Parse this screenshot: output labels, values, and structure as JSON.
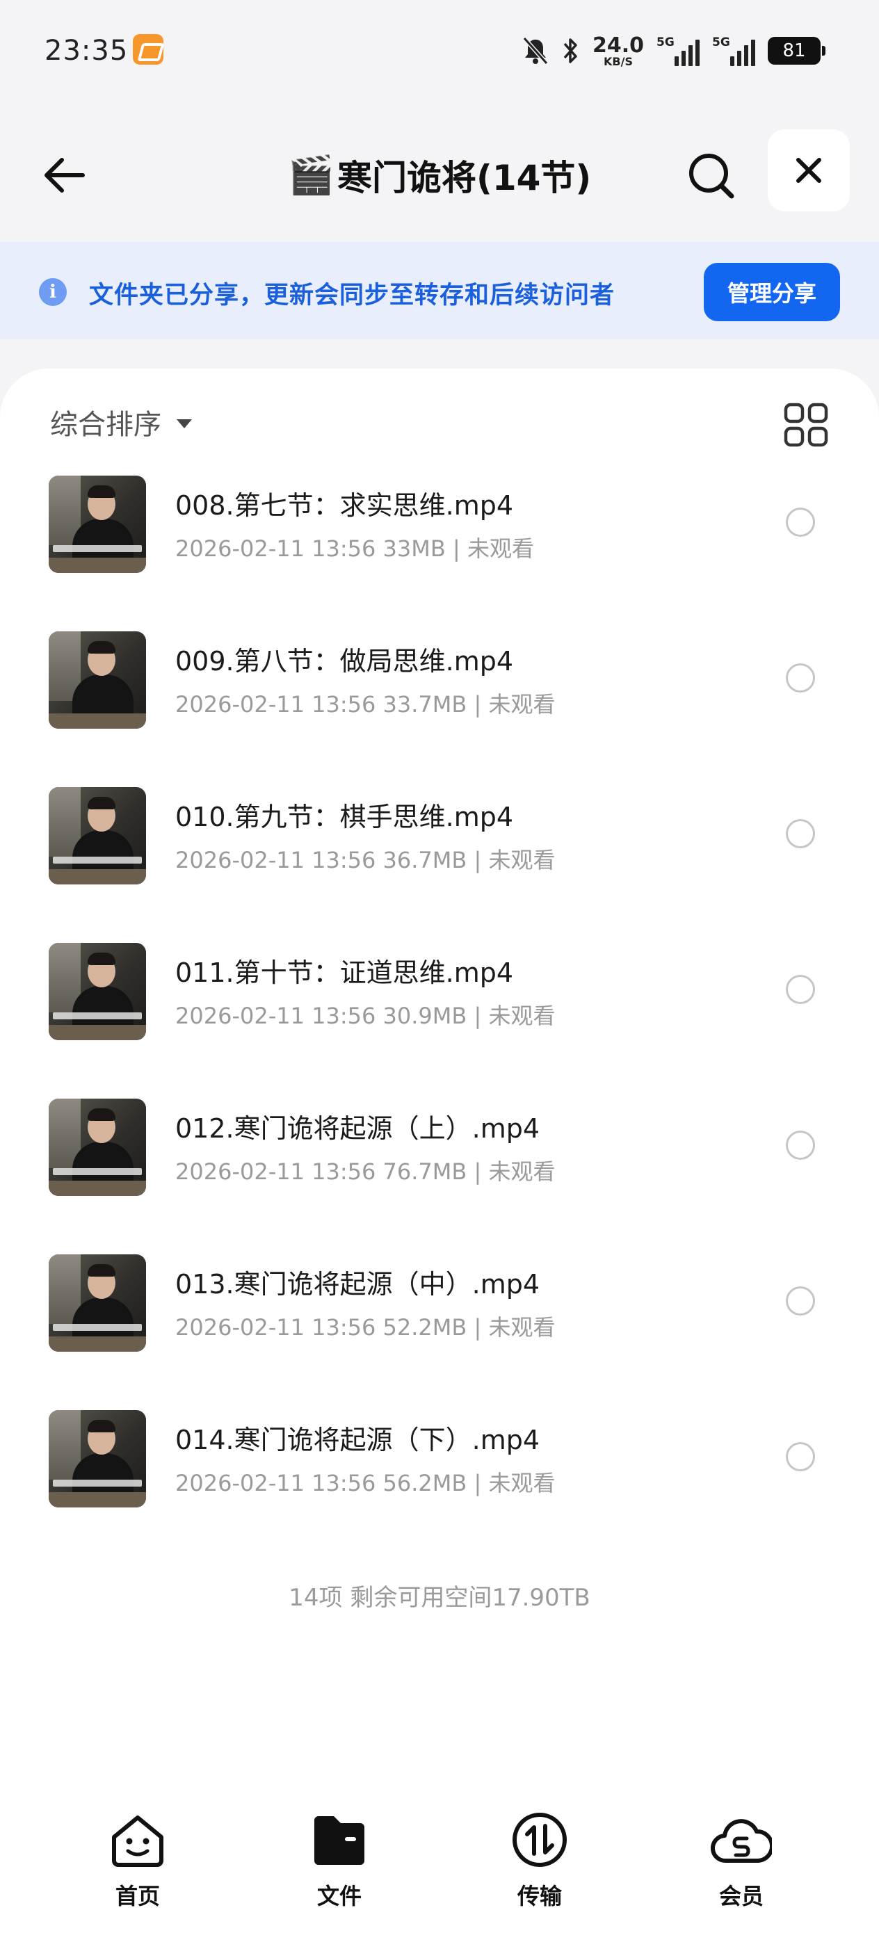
{
  "status_bar": {
    "time": "23:35",
    "net_speed_value": "24.0",
    "net_speed_unit": "KB/S",
    "signal1_label": "5G",
    "signal2_label": "5G",
    "battery": "81",
    "icons": [
      "app-badge-icon",
      "mute-bell-icon",
      "bluetooth-icon",
      "signal-icon",
      "battery-icon"
    ]
  },
  "header": {
    "title_emoji": "🎬",
    "title": "寒门诡将(14节)"
  },
  "share_banner": {
    "text": "文件夹已分享，更新会同步至转存和后续访问者",
    "button": "管理分享",
    "accent_color": "#1366f0"
  },
  "toolbar": {
    "sort_label": "综合排序"
  },
  "files": [
    {
      "name": "008.第七节：求实思维.mp4",
      "meta": "2026-02-11 13:56  33MB | 未观看"
    },
    {
      "name": "009.第八节：做局思维.mp4",
      "meta": "2026-02-11 13:56  33.7MB | 未观看"
    },
    {
      "name": "010.第九节：棋手思维.mp4",
      "meta": "2026-02-11 13:56  36.7MB | 未观看"
    },
    {
      "name": "011.第十节：证道思维.mp4",
      "meta": "2026-02-11 13:56  30.9MB | 未观看"
    },
    {
      "name": "012.寒门诡将起源（上）.mp4",
      "meta": "2026-02-11 13:56  76.7MB | 未观看"
    },
    {
      "name": "013.寒门诡将起源（中）.mp4",
      "meta": "2026-02-11 13:56  52.2MB | 未观看"
    },
    {
      "name": "014.寒门诡将起源（下）.mp4",
      "meta": "2026-02-11 13:56  56.2MB | 未观看"
    }
  ],
  "summary": "14项 剩余可用空间17.90TB",
  "bottom_nav": {
    "home": "首页",
    "files": "文件",
    "transfer": "传输",
    "member": "会员"
  }
}
